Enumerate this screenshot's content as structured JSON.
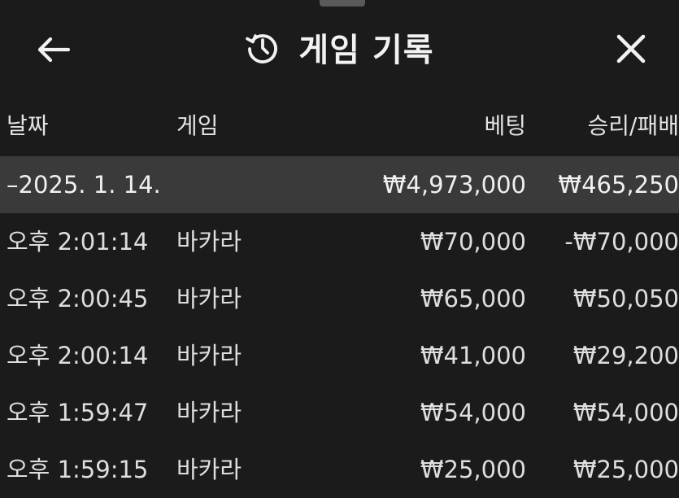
{
  "header": {
    "title": "게임 기록",
    "back_icon": "back-arrow-icon",
    "history_icon": "history-icon",
    "close_icon": "close-icon"
  },
  "table": {
    "columns": [
      "날짜",
      "게임",
      "베팅",
      "승리/패배"
    ],
    "summary": {
      "date": "–2025. 1. 14.",
      "bet": "₩4,973,000",
      "result": "₩465,250"
    },
    "rows": [
      {
        "time": "오후 2:01:14",
        "game": "바카라",
        "bet": "₩70,000",
        "result": "-₩70,000"
      },
      {
        "time": "오후 2:00:45",
        "game": "바카라",
        "bet": "₩65,000",
        "result": "₩50,050"
      },
      {
        "time": "오후 2:00:14",
        "game": "바카라",
        "bet": "₩41,000",
        "result": "₩29,200"
      },
      {
        "time": "오후 1:59:47",
        "game": "바카라",
        "bet": "₩54,000",
        "result": "₩54,000"
      },
      {
        "time": "오후 1:59:15",
        "game": "바카라",
        "bet": "₩25,000",
        "result": "₩25,000"
      }
    ]
  }
}
